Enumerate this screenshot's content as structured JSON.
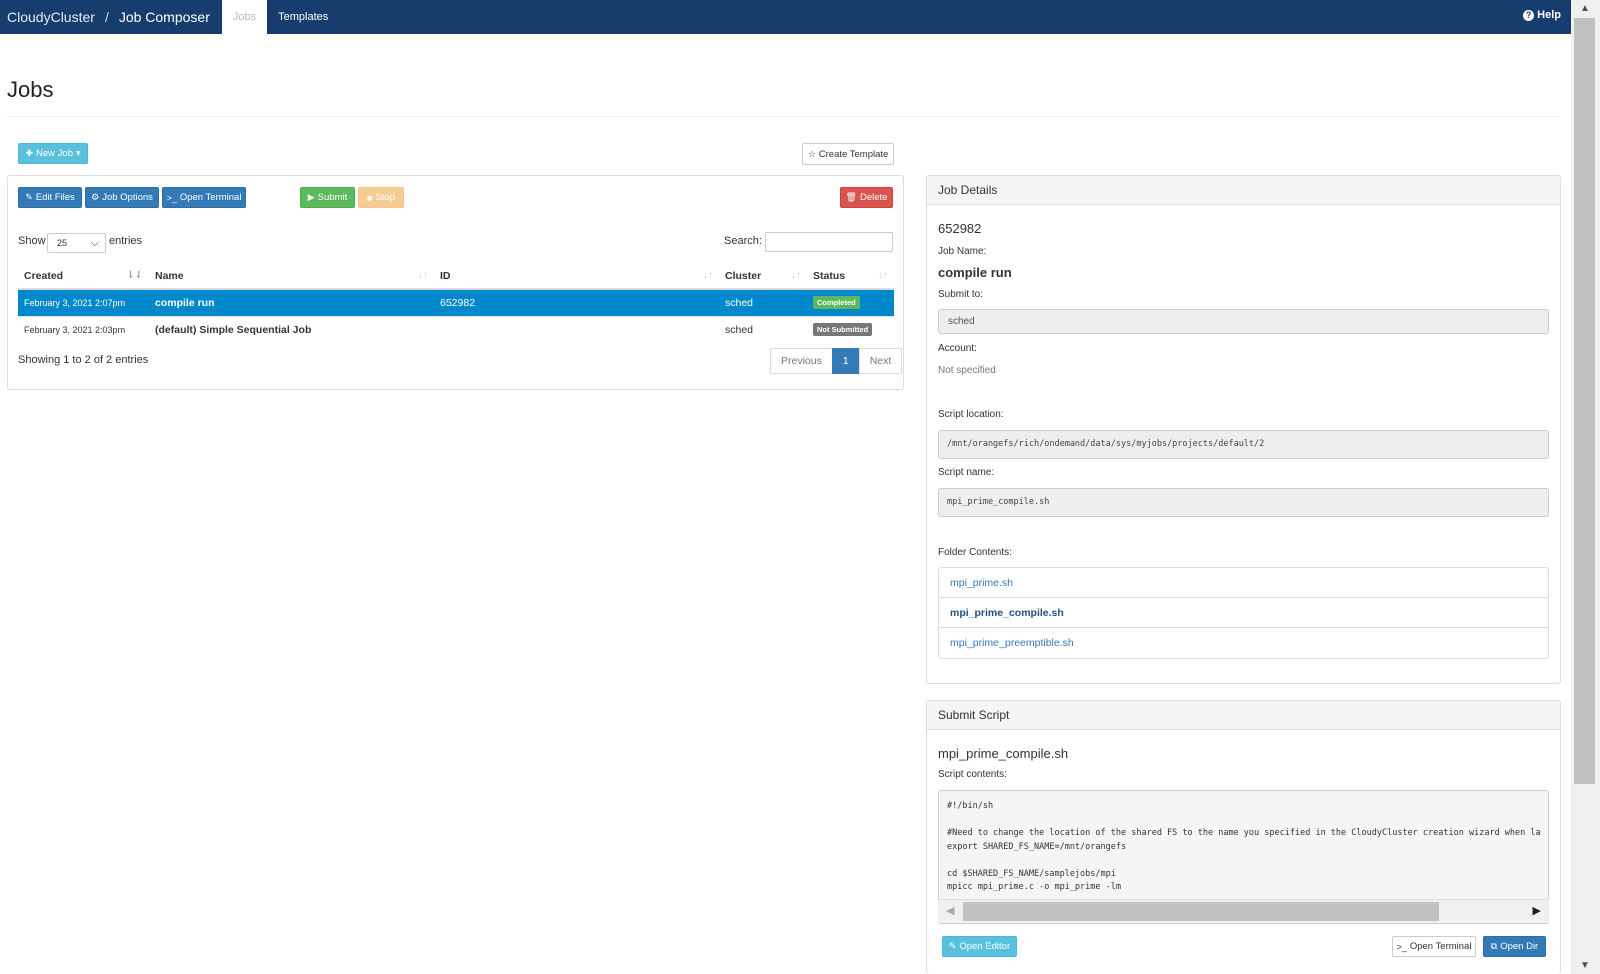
{
  "navbar": {
    "brand": "CloudyCluster",
    "separator": "/",
    "app": "Job Composer",
    "tab_jobs": "Jobs",
    "tab_templates": "Templates",
    "help": "Help"
  },
  "page": {
    "title": "Jobs"
  },
  "toolbar": {
    "new_job": "New Job",
    "create_template": "Create Template",
    "edit_files": "Edit Files",
    "job_options": "Job Options",
    "open_terminal": "Open Terminal",
    "submit": "Submit",
    "stop": "Stop",
    "delete": "Delete"
  },
  "table_controls": {
    "show": "Show",
    "entries_value": "25",
    "entries": "entries",
    "search": "Search:"
  },
  "table": {
    "columns": [
      "Created",
      "Name",
      "ID",
      "Cluster",
      "Status"
    ],
    "rows": [
      {
        "created": "February 3, 2021 2:07pm",
        "name": "compile run",
        "id": "652982",
        "cluster": "sched",
        "status": "Completed"
      },
      {
        "created": "February 3, 2021 2:03pm",
        "name": "(default) Simple Sequential Job",
        "id": "",
        "cluster": "sched",
        "status": "Not Submitted"
      }
    ],
    "info": "Showing 1 to 2 of 2 entries",
    "pager": {
      "previous": "Previous",
      "page": "1",
      "next": "Next"
    }
  },
  "job_details": {
    "header": "Job Details",
    "id": "652982",
    "job_name_label": "Job Name:",
    "job_name": "compile run",
    "submit_to_label": "Submit to:",
    "submit_to": "sched",
    "account_label": "Account:",
    "account": "Not specified",
    "script_location_label": "Script location:",
    "script_location": "/mnt/orangefs/rich/ondemand/data/sys/myjobs/projects/default/2",
    "script_name_label": "Script name:",
    "script_name": "mpi_prime_compile.sh",
    "folder_contents_label": "Folder Contents:",
    "folder_contents": [
      "mpi_prime.sh",
      "mpi_prime_compile.sh",
      "mpi_prime_preemptible.sh"
    ]
  },
  "submit_script": {
    "header": "Submit Script",
    "filename": "mpi_prime_compile.sh",
    "contents_label": "Script contents:",
    "contents": "#!/bin/sh\n\n#Need to change the location of the shared FS to the name you specified in the CloudyCluster creation wizard when la\nexport SHARED_FS_NAME=/mnt/orangefs\n\ncd $SHARED_FS_NAME/samplejobs/mpi\nmpicc mpi_prime.c -o mpi_prime -lm",
    "open_editor": "Open Editor",
    "open_terminal": "Open Terminal",
    "open_dir": "Open Dir"
  },
  "colors": {
    "navbar": "#173d6e",
    "selected_row": "#0088cc",
    "primary": "#337ab7",
    "success": "#5cb85c",
    "danger": "#d9534f",
    "info": "#5bc0de",
    "warning": "#f0ad4e"
  }
}
